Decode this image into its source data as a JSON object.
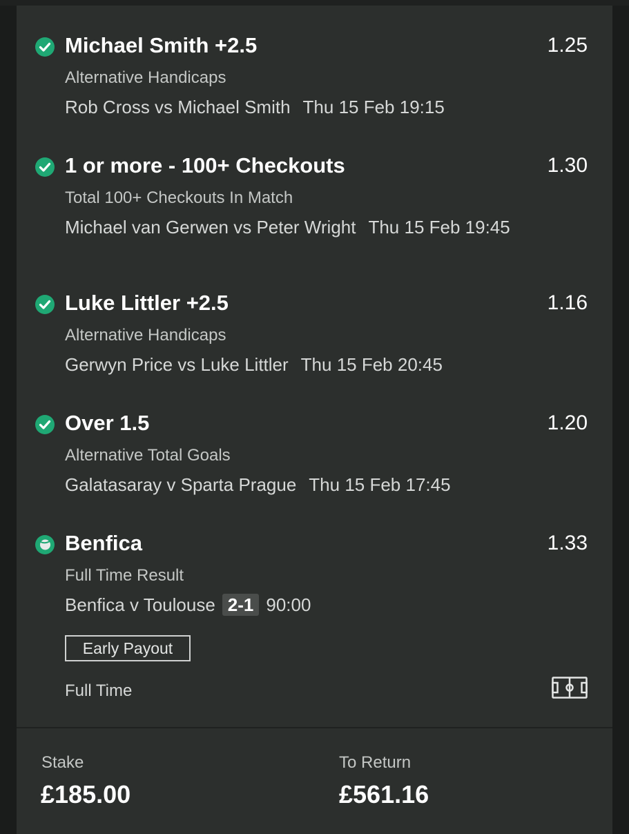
{
  "selections": [
    {
      "name": "Michael Smith +2.5",
      "odds": "1.25",
      "market": "Alternative Handicaps",
      "event": "Rob Cross vs Michael Smith",
      "time": "Thu 15 Feb 19:15",
      "status_icon": "check-circle-icon"
    },
    {
      "name": "1 or more - 100+ Checkouts",
      "odds": "1.30",
      "market": "Total 100+ Checkouts In Match",
      "event": "Michael van Gerwen vs Peter Wright",
      "time": "Thu 15 Feb 19:45",
      "status_icon": "check-circle-icon"
    },
    {
      "name": "Luke Littler +2.5",
      "odds": "1.16",
      "market": "Alternative Handicaps",
      "event": "Gerwyn Price vs Luke Littler",
      "time": "Thu 15 Feb 20:45",
      "status_icon": "check-circle-icon"
    },
    {
      "name": "Over 1.5",
      "odds": "1.20",
      "market": "Alternative Total Goals",
      "event": "Galatasaray v Sparta Prague",
      "time": "Thu 15 Feb 17:45",
      "status_icon": "check-circle-icon"
    },
    {
      "name": "Benfica",
      "odds": "1.33",
      "market": "Full Time Result",
      "event": "Benfica v Toulouse",
      "score": "2-1",
      "clock": "90:00",
      "status_icon": "in-play-circle-icon",
      "early_payout_label": "Early Payout",
      "status_text": "Full Time",
      "pitch_icon": "football-pitch-icon"
    }
  ],
  "footer": {
    "stake_label": "Stake",
    "stake_value": "£185.00",
    "return_label": "To Return",
    "return_value": "£561.16"
  },
  "colors": {
    "background": "#1a1c1b",
    "card": "#2c2f2d",
    "check_green": "#1fa874",
    "text_muted": "#c4c7c5"
  }
}
